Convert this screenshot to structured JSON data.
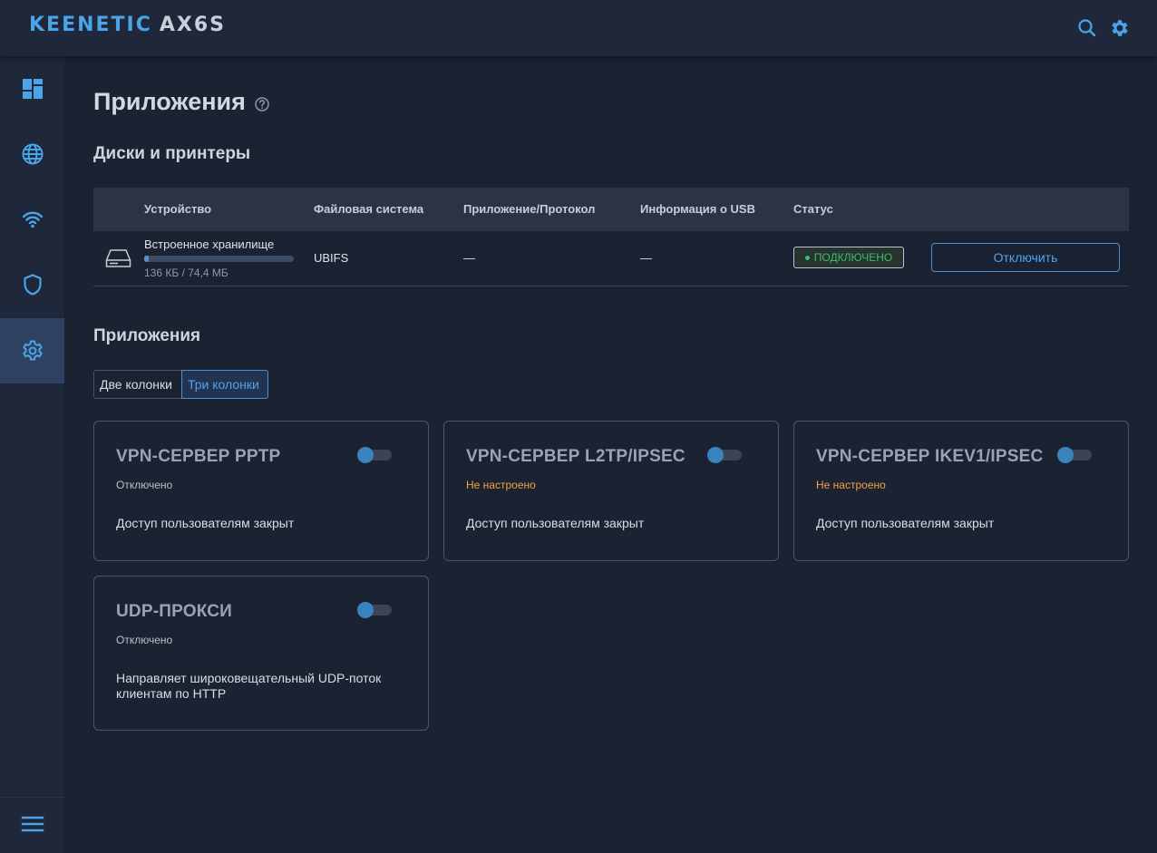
{
  "header": {
    "brand": "KEENETIC",
    "model": "AX6S",
    "search_icon": "search-icon",
    "settings_icon": "gear-icon"
  },
  "sidebar": {
    "items": [
      {
        "icon": "dashboard-icon",
        "active": false
      },
      {
        "icon": "globe-icon",
        "active": false
      },
      {
        "icon": "wifi-icon",
        "active": false
      },
      {
        "icon": "shield-icon",
        "active": false
      },
      {
        "icon": "gear-icon",
        "active": true
      }
    ],
    "menu_icon": "hamburger-menu-icon"
  },
  "page": {
    "title": "Приложения",
    "help_icon": "help-circle-icon"
  },
  "disks": {
    "section_title": "Диски и принтеры",
    "columns": [
      "Устройство",
      "Файловая система",
      "Приложение/Протокол",
      "Информация о USB",
      "Статус"
    ],
    "rows": [
      {
        "icon": "hard-drive-icon",
        "device": "Встроенное хранилище",
        "usage": "136 КБ / 74,4 МБ",
        "usage_fraction": 0.0018,
        "filesystem": "UBIFS",
        "protocol": "—",
        "usb_info": "—",
        "status": "ПОДКЛЮЧЕНО",
        "action": "Отключить"
      }
    ]
  },
  "apps": {
    "section_title": "Приложения",
    "layout_options": [
      "Две колонки",
      "Три колонки"
    ],
    "selected_layout": "Три колонки",
    "cards": [
      {
        "title": "VPN-СЕРВЕР PPTP",
        "status": "Отключено",
        "status_kind": "off",
        "description": "Доступ пользователям закрыт",
        "enabled": false
      },
      {
        "title": "VPN-СЕРВЕР L2TP/IPSEC",
        "status": "Не настроено",
        "status_kind": "warn",
        "description": "Доступ пользователям закрыт",
        "enabled": false
      },
      {
        "title": "VPN-СЕРВЕР IKEV1/IPSEC",
        "status": "Не настроено",
        "status_kind": "warn",
        "description": "Доступ пользователям закрыт",
        "enabled": false
      },
      {
        "title": "UDP-ПРОКСИ",
        "status": "Отключено",
        "status_kind": "off",
        "description": "Направляет широковещательный UDP-поток клиентам по HTTP",
        "enabled": false
      }
    ]
  },
  "colors": {
    "accent": "#4aa4e8",
    "background": "#1b2333",
    "panel": "#1f283a",
    "status_ok": "#3dbd6b",
    "status_warn": "#f5a340"
  }
}
